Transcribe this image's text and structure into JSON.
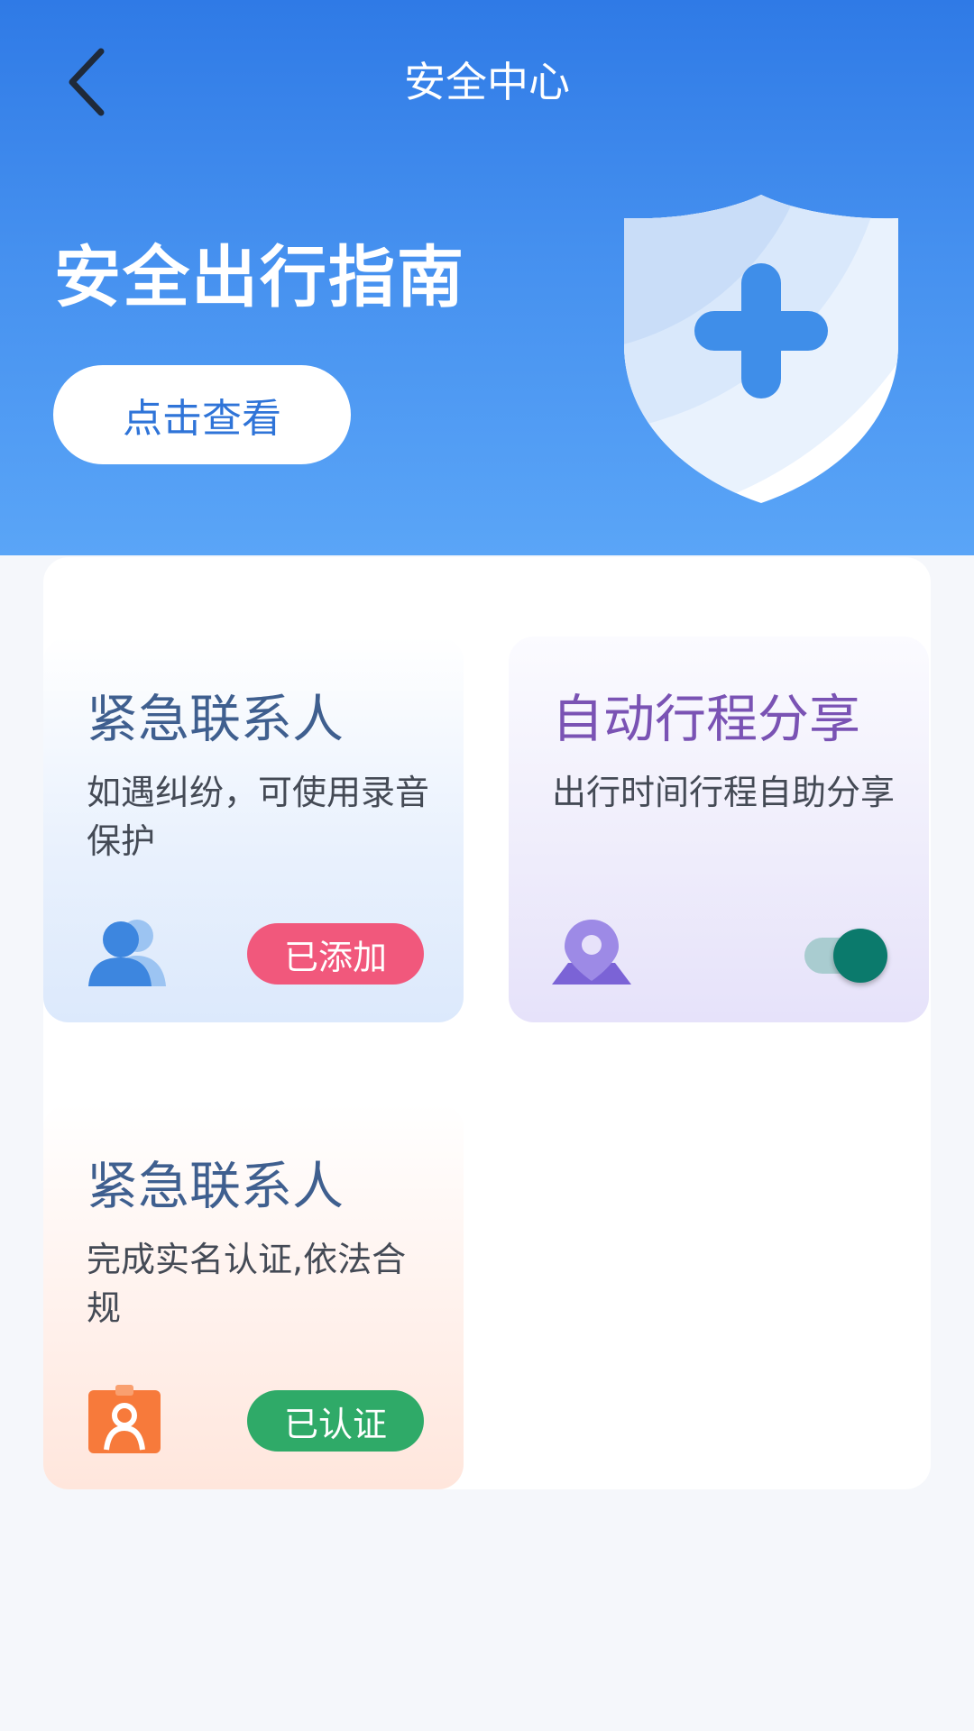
{
  "header": {
    "title": "安全中心",
    "back_icon": "chevron-left-icon"
  },
  "banner": {
    "title": "安全出行指南",
    "button_label": "点击查看",
    "illustration": "shield-plus-icon"
  },
  "cards": [
    {
      "title": "紧急联系人",
      "description": "如遇纠纷，可使用录音保护",
      "icon": "contacts-icon",
      "badge": "已添加",
      "badge_color": "#f1587c",
      "title_color": "#3f5f8f"
    },
    {
      "title": "自动行程分享",
      "description": "出行时间行程自助分享",
      "icon": "location-pin-icon",
      "toggle_on": true,
      "title_color": "#7a53b4"
    },
    {
      "title": "紧急联系人",
      "description": "完成实名认证,依法合规",
      "icon": "id-badge-icon",
      "badge": "已认证",
      "badge_color": "#2faa68",
      "title_color": "#3f5f8f"
    }
  ],
  "colors": {
    "banner_top": "#2f7ae6",
    "banner_bottom": "#5aa5f7",
    "toggle_thumb": "#0b7a6c"
  }
}
